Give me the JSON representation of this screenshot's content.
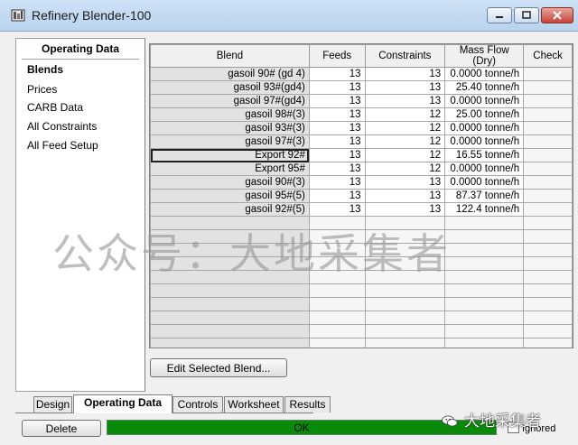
{
  "window": {
    "title": "Refinery Blender-100",
    "icon": "app-icon",
    "controls": [
      "minimize-icon",
      "maximize-icon",
      "close-icon"
    ]
  },
  "left_panel": {
    "header": "Operating Data",
    "items": [
      {
        "label": "Blends",
        "active": true
      },
      {
        "label": "Prices",
        "active": false
      },
      {
        "label": "CARB Data",
        "active": false
      },
      {
        "label": "All Constraints",
        "active": false
      },
      {
        "label": "All Feed Setup",
        "active": false
      }
    ]
  },
  "grid": {
    "columns": [
      "Blend",
      "Feeds",
      "Constraints",
      "Mass Flow (Dry)",
      "Check"
    ],
    "rows": [
      {
        "blend": "gasoil 90# (gd 4)",
        "feeds": "13",
        "constraints": "13",
        "mass_flow": "0.0000 tonne/h",
        "check": ""
      },
      {
        "blend": "gasoil 93#(gd4)",
        "feeds": "13",
        "constraints": "13",
        "mass_flow": "25.40 tonne/h",
        "check": ""
      },
      {
        "blend": "gasoil 97#(gd4)",
        "feeds": "13",
        "constraints": "13",
        "mass_flow": "0.0000 tonne/h",
        "check": ""
      },
      {
        "blend": "gasoil 98#(3)",
        "feeds": "13",
        "constraints": "12",
        "mass_flow": "25.00 tonne/h",
        "check": ""
      },
      {
        "blend": "gasoil 93#(3)",
        "feeds": "13",
        "constraints": "12",
        "mass_flow": "0.0000 tonne/h",
        "check": ""
      },
      {
        "blend": "gasoil 97#(3)",
        "feeds": "13",
        "constraints": "12",
        "mass_flow": "0.0000 tonne/h",
        "check": ""
      },
      {
        "blend": "Export 92#",
        "feeds": "13",
        "constraints": "12",
        "mass_flow": "16.55 tonne/h",
        "check": ""
      },
      {
        "blend": "Export 95#",
        "feeds": "13",
        "constraints": "12",
        "mass_flow": "0.0000 tonne/h",
        "check": ""
      },
      {
        "blend": "gasoil 90#(3)",
        "feeds": "13",
        "constraints": "13",
        "mass_flow": "0.0000 tonne/h",
        "check": ""
      },
      {
        "blend": "gasoil 95#(5)",
        "feeds": "13",
        "constraints": "13",
        "mass_flow": "87.37 tonne/h",
        "check": ""
      },
      {
        "blend": "gasoil 92#(5)",
        "feeds": "13",
        "constraints": "13",
        "mass_flow": "122.4 tonne/h",
        "check": ""
      }
    ],
    "selected_row": 6,
    "empty_rows": 10
  },
  "buttons": {
    "edit_selected_blend": "Edit Selected Blend...",
    "delete": "Delete"
  },
  "tabs": [
    {
      "label": "Design",
      "active": false
    },
    {
      "label": "Operating Data",
      "active": true
    },
    {
      "label": "Controls",
      "active": false
    },
    {
      "label": "Worksheet",
      "active": false
    },
    {
      "label": "Results",
      "active": false
    }
  ],
  "status": {
    "text": "OK",
    "color": "#0a8a0a"
  },
  "ignored": {
    "label": "Ignored",
    "checked": false
  },
  "watermark": {
    "main": "公众号：大地采集者",
    "corner": "大地采集者"
  }
}
